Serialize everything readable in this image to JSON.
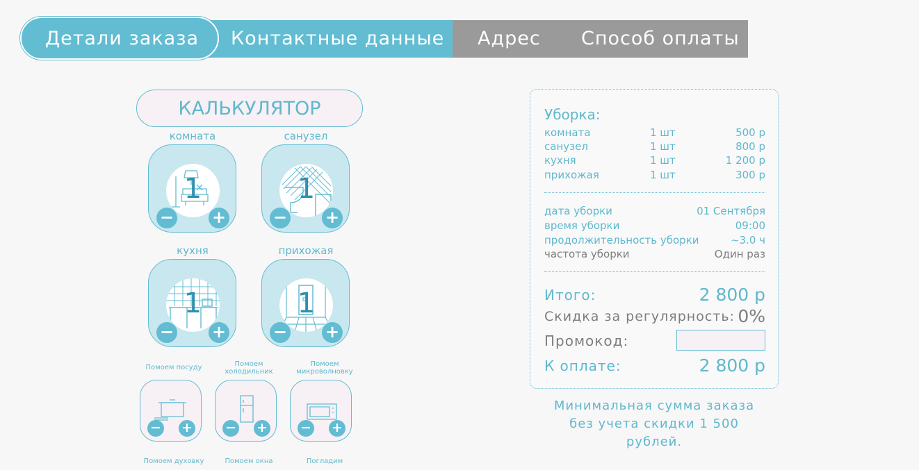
{
  "tabs": [
    {
      "label": "Детали заказа",
      "state": "active"
    },
    {
      "label": "Контактные данные",
      "state": "next"
    },
    {
      "label": "Адрес",
      "state": "inactive"
    },
    {
      "label": "Способ оплаты",
      "state": "inactive"
    }
  ],
  "calculator": {
    "title": "КАЛЬКУЛЯТОР",
    "rooms": [
      {
        "label": "комната",
        "count": "1",
        "icon": "living-room-icon"
      },
      {
        "label": "санузел",
        "count": "1",
        "icon": "bathroom-icon"
      },
      {
        "label": "кухня",
        "count": "1",
        "icon": "kitchen-icon"
      },
      {
        "label": "прихожая",
        "count": "1",
        "icon": "hallway-icon"
      }
    ],
    "extras": [
      {
        "label": "Помоем посуду",
        "icon": "cooking-pot-icon"
      },
      {
        "label": "Помоем холодильник",
        "icon": "fridge-icon"
      },
      {
        "label": "Помоем микроволновку",
        "icon": "microwave-icon"
      }
    ],
    "extras_next": [
      {
        "label": "Помоем духовку"
      },
      {
        "label": "Помоем окна"
      },
      {
        "label": "Погладим"
      }
    ],
    "minus_symbol": "−",
    "plus_symbol": "+"
  },
  "summary": {
    "heading": "Уборка:",
    "items": [
      {
        "name": "комната",
        "qty": "1 шт",
        "price": "500 р"
      },
      {
        "name": "санузел",
        "qty": "1 шт",
        "price": "800 р"
      },
      {
        "name": "кухня",
        "qty": "1 шт",
        "price": "1 200 р"
      },
      {
        "name": "прихожая",
        "qty": "1 шт",
        "price": "300 р"
      }
    ],
    "details": [
      {
        "label": "дата уборки",
        "value": "01 Сентября"
      },
      {
        "label": "время уборки",
        "value": "09:00"
      },
      {
        "label": "продолжительность уборки",
        "value": "~3.0 ч"
      },
      {
        "label": "частота уборки",
        "value": "Один раз"
      }
    ],
    "total_label": "Итого:",
    "total_value": "2 800 р",
    "discount_label": "Скидка за регулярность:",
    "discount_value": "0%",
    "promo_label": "Промокод:",
    "promo_value": "",
    "pay_label": "К оплате:",
    "pay_value": "2 800 р"
  },
  "min_note": {
    "line1": "Минимальная сумма заказа",
    "line2": "без учета скидки 1 500",
    "line3": "рублей."
  },
  "colors": {
    "accent": "#62bcd2",
    "tab_inactive": "#9a9a9a",
    "card_bg": "#c9e7ee",
    "card_light": "#f7f0f5",
    "count_text": "#2f8fb0",
    "page_bg": "#f7f7f8"
  }
}
